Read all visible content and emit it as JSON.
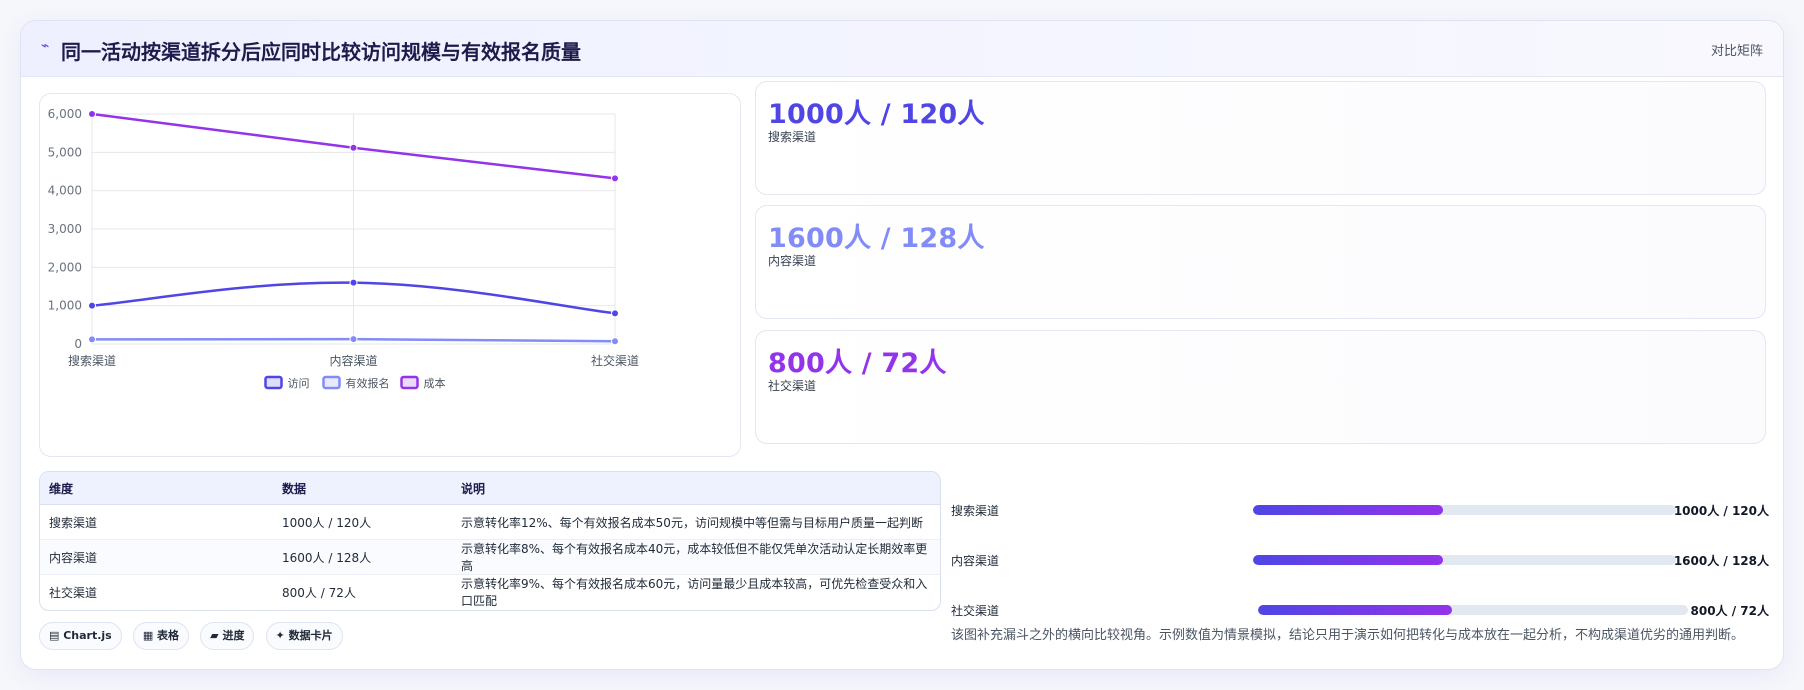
{
  "header": {
    "title": "同一活动按渠道拆分后应同时比较访问规模与有效报名质量",
    "tag": "对比矩阵"
  },
  "colors": {
    "visit": "#4f46e5",
    "signup": "#818cf8",
    "cost": "#9333ea"
  },
  "chart_data": {
    "type": "line",
    "categories": [
      "搜索渠道",
      "内容渠道",
      "社交渠道"
    ],
    "series": [
      {
        "name": "访问",
        "values": [
          1000,
          1600,
          800
        ],
        "color": "#4f46e5"
      },
      {
        "name": "有效报名",
        "values": [
          120,
          128,
          72
        ],
        "color": "#818cf8"
      },
      {
        "name": "成本",
        "values": [
          6000,
          5120,
          4320
        ],
        "color": "#9333ea"
      }
    ],
    "ylim": [
      0,
      6000
    ],
    "yticks": [
      "0",
      "1,000",
      "2,000",
      "3,000",
      "4,000",
      "5,000",
      "6,000"
    ],
    "ytick_values": [
      0,
      1000,
      2000,
      3000,
      4000,
      5000,
      6000
    ],
    "grid": true,
    "legend": "bottom"
  },
  "kpis": [
    {
      "value": "1000人 / 120人",
      "label": "搜索渠道",
      "color": "#4f46e5"
    },
    {
      "value": "1600人 / 128人",
      "label": "内容渠道",
      "color": "#818cf8"
    },
    {
      "value": "800人 / 72人",
      "label": "社交渠道",
      "color": "#9333ea"
    }
  ],
  "table": {
    "headers": [
      "维度",
      "数据",
      "说明"
    ],
    "rows": [
      [
        "搜索渠道",
        "1000人 / 120人",
        "示意转化率12%、每个有效报名成本50元，访问规模中等但需与目标用户质量一起判断"
      ],
      [
        "内容渠道",
        "1600人 / 128人",
        "示意转化率8%、每个有效报名成本40元，成本较低但不能仅凭单次活动认定长期效率更高"
      ],
      [
        "社交渠道",
        "800人 / 72人",
        "示意转化率9%、每个有效报名成本60元，访问量最少且成本较高，可优先检查受众和入口匹配"
      ]
    ]
  },
  "chips": [
    "▤ Chart.js",
    "▦ 表格",
    "▰ 进度",
    "✦ 数据卡片"
  ],
  "progress": [
    {
      "label": "搜索渠道",
      "value": "1000人 / 120人",
      "fill": 0.45
    },
    {
      "label": "内容渠道",
      "value": "1600人 / 128人",
      "fill": 0.45
    },
    {
      "label": "社交渠道",
      "value": "800人 / 72人",
      "fill": 0.45
    }
  ],
  "note": "该图补充漏斗之外的横向比较视角。示例数值为情景模拟，结论只用于演示如何把转化与成本放在一起分析，不构成渠道优劣的通用判断。"
}
